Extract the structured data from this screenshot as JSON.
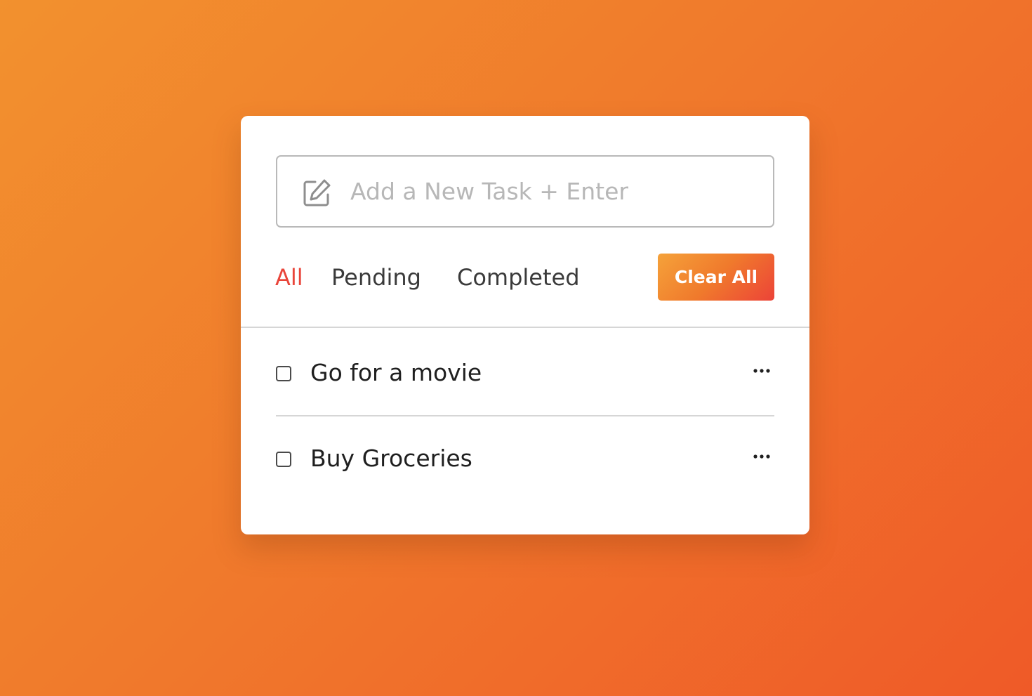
{
  "input": {
    "placeholder": "Add a New Task + Enter",
    "value": "",
    "icon": "edit-icon"
  },
  "filters": [
    {
      "label": "All",
      "active": true
    },
    {
      "label": "Pending",
      "active": false
    },
    {
      "label": "Completed",
      "active": false
    }
  ],
  "clear_button": {
    "label": "Clear All"
  },
  "tasks": [
    {
      "label": "Go for a movie",
      "completed": false,
      "menu_icon": "more-horizontal-icon"
    },
    {
      "label": "Buy Groceries",
      "completed": false,
      "menu_icon": "more-horizontal-icon"
    }
  ],
  "colors": {
    "accent": "#e9453a",
    "background_start": "#f2912e",
    "background_end": "#ef5a28"
  }
}
